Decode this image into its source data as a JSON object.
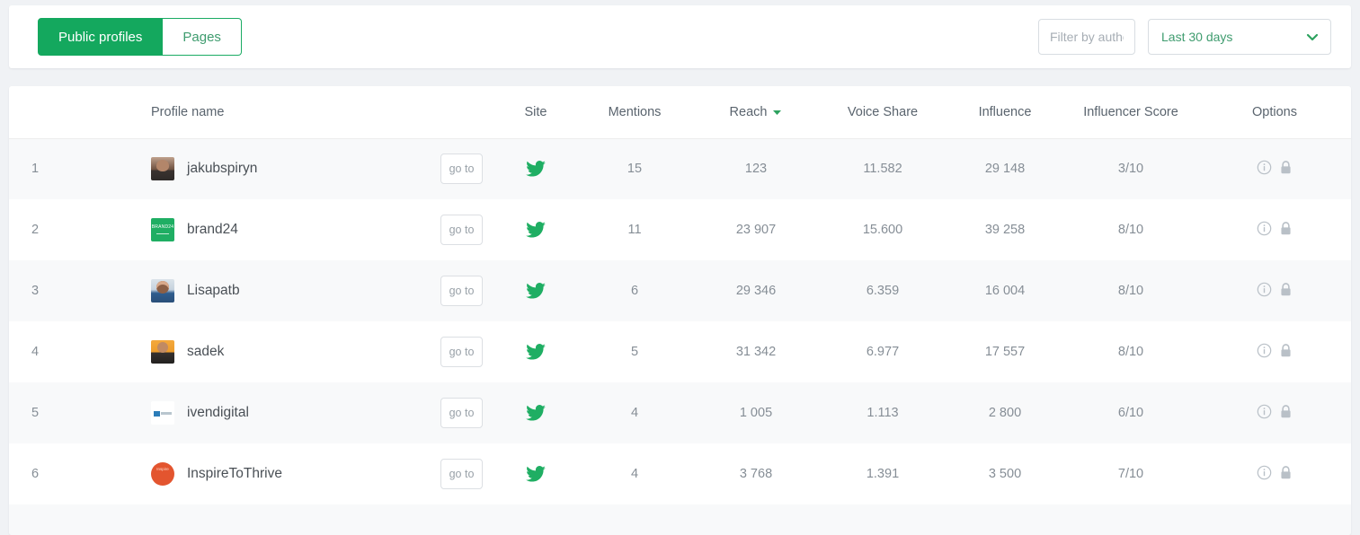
{
  "toolbar": {
    "tabs": [
      {
        "label": "Public profiles",
        "active": true
      },
      {
        "label": "Pages",
        "active": false
      }
    ],
    "filter": {
      "placeholder": "Filter by author",
      "value": ""
    },
    "date_range": {
      "value": "Last 30 days"
    }
  },
  "table": {
    "columns": [
      {
        "key": "rank",
        "label": ""
      },
      {
        "key": "name",
        "label": "Profile name"
      },
      {
        "key": "goto",
        "label": ""
      },
      {
        "key": "site",
        "label": "Site"
      },
      {
        "key": "mentions",
        "label": "Mentions"
      },
      {
        "key": "reach",
        "label": "Reach",
        "sorted": true,
        "sort_dir": "desc"
      },
      {
        "key": "voice_share",
        "label": "Voice Share"
      },
      {
        "key": "influence",
        "label": "Influence"
      },
      {
        "key": "influencer_score",
        "label": "Influencer Score"
      },
      {
        "key": "options",
        "label": "Options"
      }
    ],
    "goto_label": "go to",
    "rows": [
      {
        "rank": "1",
        "name": "jakubspiryn",
        "avatar": "photo-avatar",
        "site": "twitter-icon",
        "mentions": "15",
        "reach": "123",
        "voice_share": "11.582",
        "influence": "29 148",
        "influencer_score": "3/10"
      },
      {
        "rank": "2",
        "name": "brand24",
        "avatar": "brand-logo-avatar",
        "site": "twitter-icon",
        "mentions": "11",
        "reach": "23 907",
        "voice_share": "15.600",
        "influence": "39 258",
        "influencer_score": "8/10"
      },
      {
        "rank": "3",
        "name": "Lisapatb",
        "avatar": "photo-avatar",
        "site": "twitter-icon",
        "mentions": "6",
        "reach": "29 346",
        "voice_share": "6.359",
        "influence": "16 004",
        "influencer_score": "8/10"
      },
      {
        "rank": "4",
        "name": "sadek",
        "avatar": "photo-avatar",
        "site": "twitter-icon",
        "mentions": "5",
        "reach": "31 342",
        "voice_share": "6.977",
        "influence": "17 557",
        "influencer_score": "8/10"
      },
      {
        "rank": "5",
        "name": "ivendigital",
        "avatar": "brand-logo-avatar",
        "site": "twitter-icon",
        "mentions": "4",
        "reach": "1 005",
        "voice_share": "1.113",
        "influence": "2 800",
        "influencer_score": "6/10"
      },
      {
        "rank": "6",
        "name": "InspireToThrive",
        "avatar": "brand-logo-avatar",
        "site": "twitter-icon",
        "mentions": "4",
        "reach": "3 768",
        "voice_share": "1.391",
        "influence": "3 500",
        "influencer_score": "7/10"
      }
    ],
    "row_icons": {
      "info": "info-icon",
      "lock": "lock-icon"
    }
  },
  "avatar_text": {
    "brand24": "BRAND24",
    "inspire_line1": "Inspire",
    "inspire_line2": "to",
    "inspire_line3": "Thrive"
  },
  "colors": {
    "accent_green": "#14a85e",
    "link_green": "#3f9c6f",
    "twitter_green": "#1fae63",
    "page_bg": "#f0f2f5",
    "row_alt_bg": "#f8f9fa",
    "text_muted": "#868e96"
  }
}
